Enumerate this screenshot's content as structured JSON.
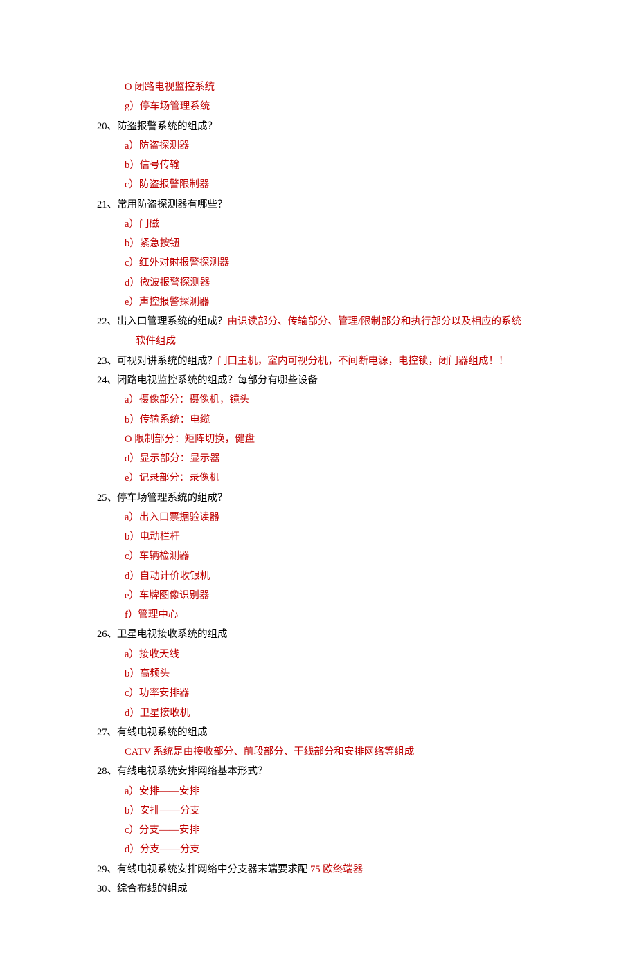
{
  "lines": [
    {
      "cls": "sub red",
      "text": "O 闭路电视监控系统"
    },
    {
      "cls": "sub red",
      "text": "g）停车场管理系统"
    },
    {
      "cls": "q",
      "parts": [
        {
          "cls": "",
          "text": "20、防盗报警系统的组成？"
        }
      ]
    },
    {
      "cls": "sub red",
      "text": "a）防盗探测器"
    },
    {
      "cls": "sub red",
      "text": "b）信号传输"
    },
    {
      "cls": "sub red",
      "text": "c）防盗报警限制器"
    },
    {
      "cls": "q",
      "parts": [
        {
          "cls": "",
          "text": "21、常用防盗探测器有哪些？"
        }
      ]
    },
    {
      "cls": "sub red",
      "text": "a）门磁"
    },
    {
      "cls": "sub red",
      "text": "b）紧急按钮"
    },
    {
      "cls": "sub red",
      "text": "c）红外对射报警探测器"
    },
    {
      "cls": "sub red",
      "text": "d）微波报警探测器"
    },
    {
      "cls": "sub red",
      "text": "e）声控报警探测器"
    },
    {
      "cls": "q",
      "parts": [
        {
          "cls": "",
          "text": "22、出入口管理系统的组成？"
        },
        {
          "cls": "red",
          "text": "由识读部分、传输部分、管理/限制部分和执行部分以及相应的系统"
        }
      ]
    },
    {
      "cls": "ans-indent red",
      "text": "软件组成"
    },
    {
      "cls": "q",
      "parts": [
        {
          "cls": "",
          "text": "23、可视对讲系统的组成？"
        },
        {
          "cls": "red",
          "text": "门口主机，室内可视分机，不间断电源，电控锁，闭门器组成！！"
        }
      ]
    },
    {
      "cls": "q",
      "parts": [
        {
          "cls": "",
          "text": "24、闭路电视监控系统的组成？每部分有哪些设备"
        }
      ]
    },
    {
      "cls": "sub red",
      "text": "a）摄像部分：摄像机，镜头"
    },
    {
      "cls": "sub red",
      "text": "b）传输系统：电缆"
    },
    {
      "cls": "sub red",
      "text": "O 限制部分：矩阵切换，健盘"
    },
    {
      "cls": "sub red",
      "text": "d）显示部分：显示器"
    },
    {
      "cls": "sub red",
      "text": "e）记录部分：录像机"
    },
    {
      "cls": "q",
      "parts": [
        {
          "cls": "",
          "text": "25、停车场管理系统的组成？"
        }
      ]
    },
    {
      "cls": "sub red",
      "text": "a）出入口票据验读器"
    },
    {
      "cls": "sub red",
      "text": "b）电动栏杆"
    },
    {
      "cls": "sub red",
      "text": "c）车辆检测器"
    },
    {
      "cls": "sub red",
      "text": "d）自动计价收银机"
    },
    {
      "cls": "sub red",
      "text": "e）车牌图像识别器"
    },
    {
      "cls": "sub red",
      "text": "f）管理中心"
    },
    {
      "cls": "q",
      "parts": [
        {
          "cls": "",
          "text": "26、卫星电视接收系统的组成"
        }
      ]
    },
    {
      "cls": "sub red",
      "text": "a）接收天线"
    },
    {
      "cls": "sub red",
      "text": "b）高频头"
    },
    {
      "cls": "sub red",
      "text": "c）功率安排器"
    },
    {
      "cls": "sub red",
      "text": "d）卫星接收机"
    },
    {
      "cls": "q",
      "parts": [
        {
          "cls": "",
          "text": "27、有线电视系统的组成"
        }
      ]
    },
    {
      "cls": "sub red",
      "text": "CATV 系统是由接收部分、前段部分、干线部分和安排网络等组成"
    },
    {
      "cls": "q",
      "parts": [
        {
          "cls": "",
          "text": "28、有线电视系统安排网络基本形式？"
        }
      ]
    },
    {
      "cls": "sub red",
      "text": "a）安排――安排"
    },
    {
      "cls": "sub red",
      "text": "b）安排――分支"
    },
    {
      "cls": "sub red",
      "text": "c）分支――安排"
    },
    {
      "cls": "sub red",
      "text": "d）分支――分支"
    },
    {
      "cls": "q",
      "parts": [
        {
          "cls": "",
          "text": "29、有线电视系统安排网络中分支器末端要求配 "
        },
        {
          "cls": "red",
          "text": "75 欧终端器"
        }
      ]
    },
    {
      "cls": "q",
      "parts": [
        {
          "cls": "",
          "text": "30、综合布线的组成"
        }
      ]
    }
  ]
}
